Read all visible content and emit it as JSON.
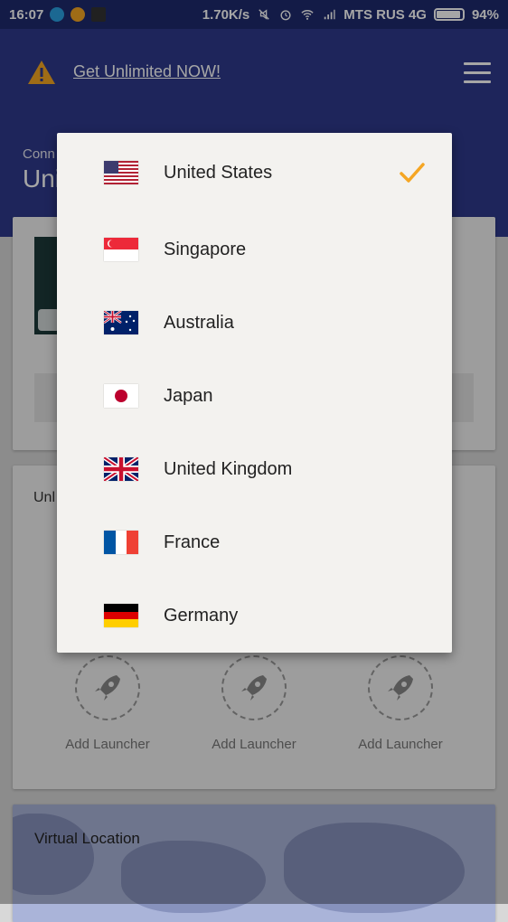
{
  "status_bar": {
    "time": "16:07",
    "speed": "1.70K/s",
    "carrier": "MTS RUS 4G",
    "battery": "94%",
    "battery_level": 0.94
  },
  "header": {
    "warning_icon": "warning-icon",
    "promo_link": "Get Unlimited NOW!",
    "menu_icon": "hamburger-menu-icon",
    "connection_status": "Conn",
    "connection_location": "Uni"
  },
  "launchers": {
    "section_title": "Unl",
    "items": [
      {
        "label": "Add Launcher",
        "icon": "rocket-icon"
      },
      {
        "label": "Add Launcher",
        "icon": "rocket-icon"
      },
      {
        "label": "Add Launcher",
        "icon": "rocket-icon"
      }
    ]
  },
  "map": {
    "title": "Virtual Location"
  },
  "location_dropdown": {
    "selected": "United States",
    "check_color": "#f5a623",
    "options": [
      {
        "label": "United States",
        "flag": "us-flag-icon",
        "selected": true
      },
      {
        "label": "Singapore",
        "flag": "sg-flag-icon",
        "selected": false
      },
      {
        "label": "Australia",
        "flag": "au-flag-icon",
        "selected": false
      },
      {
        "label": "Japan",
        "flag": "jp-flag-icon",
        "selected": false
      },
      {
        "label": "United Kingdom",
        "flag": "uk-flag-icon",
        "selected": false
      },
      {
        "label": "France",
        "flag": "fr-flag-icon",
        "selected": false
      },
      {
        "label": "Germany",
        "flag": "de-flag-icon",
        "selected": false
      }
    ]
  }
}
